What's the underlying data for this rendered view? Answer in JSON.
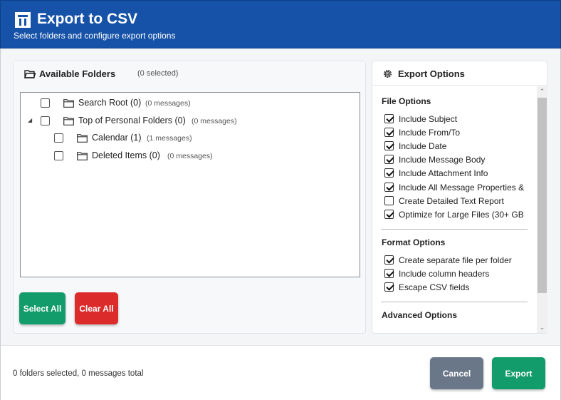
{
  "dialog": {
    "title": "Export to CSV",
    "subtitle": "Select folders and configure export options"
  },
  "folders_panel": {
    "title": "Available Folders",
    "selected_count": "(0 selected)",
    "tree": [
      {
        "name": "Search Root (0)",
        "count": "(0 messages)",
        "checked": false,
        "expander": ""
      },
      {
        "name": "Top of Personal Folders (0)",
        "count": "(0 messages)",
        "checked": false,
        "expander": "◢"
      },
      {
        "name": "Calendar (1)",
        "count": "(1 messages)",
        "checked": false,
        "expander": ""
      },
      {
        "name": "Deleted Items (0)",
        "count": "(0 messages)",
        "checked": false,
        "expander": ""
      }
    ],
    "select_all_label": "Select All",
    "clear_all_label": "Clear All"
  },
  "options_panel": {
    "title": "Export Options",
    "sections": [
      {
        "title": "File Options",
        "options": [
          {
            "label": "Include Subject",
            "checked": true
          },
          {
            "label": "Include From/To",
            "checked": true
          },
          {
            "label": "Include Date",
            "checked": true
          },
          {
            "label": "Include Message Body",
            "checked": true
          },
          {
            "label": "Include Attachment Info",
            "checked": true
          },
          {
            "label": "Include All Message Properties &",
            "checked": true
          },
          {
            "label": "Create Detailed Text Report",
            "checked": false
          },
          {
            "label": "Optimize for Large Files (30+ GB",
            "checked": true
          }
        ]
      },
      {
        "title": "Format Options",
        "options": [
          {
            "label": "Create separate file per folder",
            "checked": true
          },
          {
            "label": "Include column headers",
            "checked": true
          },
          {
            "label": "Escape CSV fields",
            "checked": true
          }
        ]
      },
      {
        "title": "Advanced Options",
        "options": []
      }
    ]
  },
  "footer": {
    "status": "0 folders selected, 0 messages total",
    "cancel_label": "Cancel",
    "export_label": "Export"
  },
  "colors": {
    "header": "#1652a8",
    "primary_green": "#129b6b",
    "danger_red": "#dc2b2b",
    "cancel_gray": "#6a7789"
  },
  "icons": {
    "header": "app-logo-icon",
    "folders": "folder-open-icon",
    "options": "gear-icon",
    "tree_item": "folder-icon"
  }
}
